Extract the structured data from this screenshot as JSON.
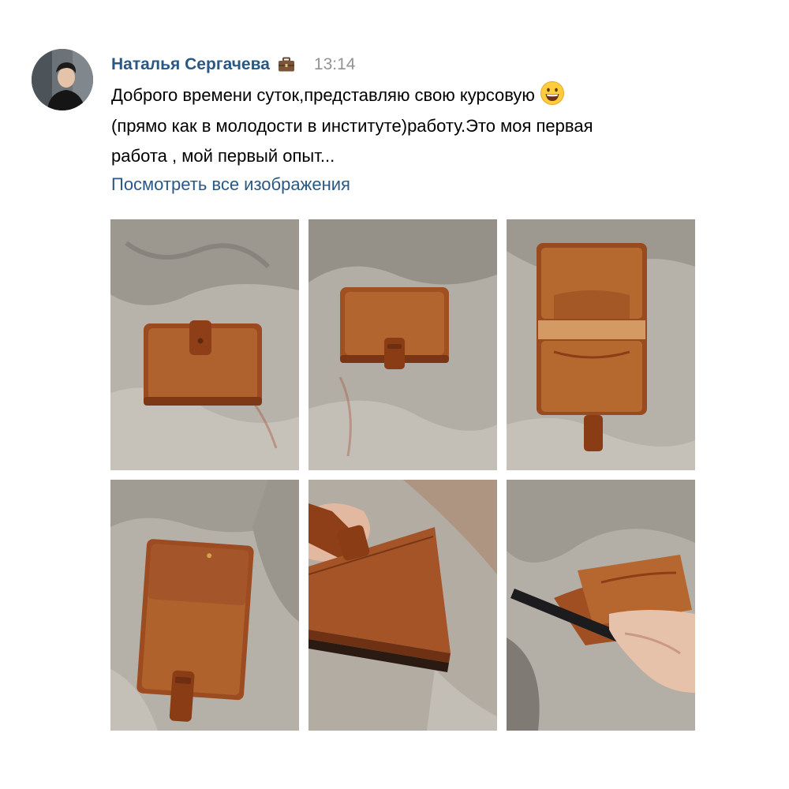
{
  "post": {
    "author": "Наталья Сергачева",
    "badge_icon": "briefcase-icon",
    "time": "13:14",
    "text_line1": "Доброго времени суток,представляю свою курсовую",
    "emoji": "grinning-face-emoji",
    "text_line2": "(прямо как в молодости в институте)работу.Это моя первая",
    "text_line3": "работа , мой первый опыт...",
    "more_link": "Посмотреть все изображения"
  },
  "colors": {
    "link": "#2a5885",
    "time": "#939393",
    "leather": "#a24f22",
    "concrete": "#b9b5ad"
  },
  "photos": [
    {
      "subject": "closed wallet with strap on concrete"
    },
    {
      "subject": "closed wallet standing with strap"
    },
    {
      "subject": "open wallet showing card pockets"
    },
    {
      "subject": "back side of wallet with strap"
    },
    {
      "subject": "hand holding wallet, edge view"
    },
    {
      "subject": "hand holding open wallet with card"
    }
  ]
}
